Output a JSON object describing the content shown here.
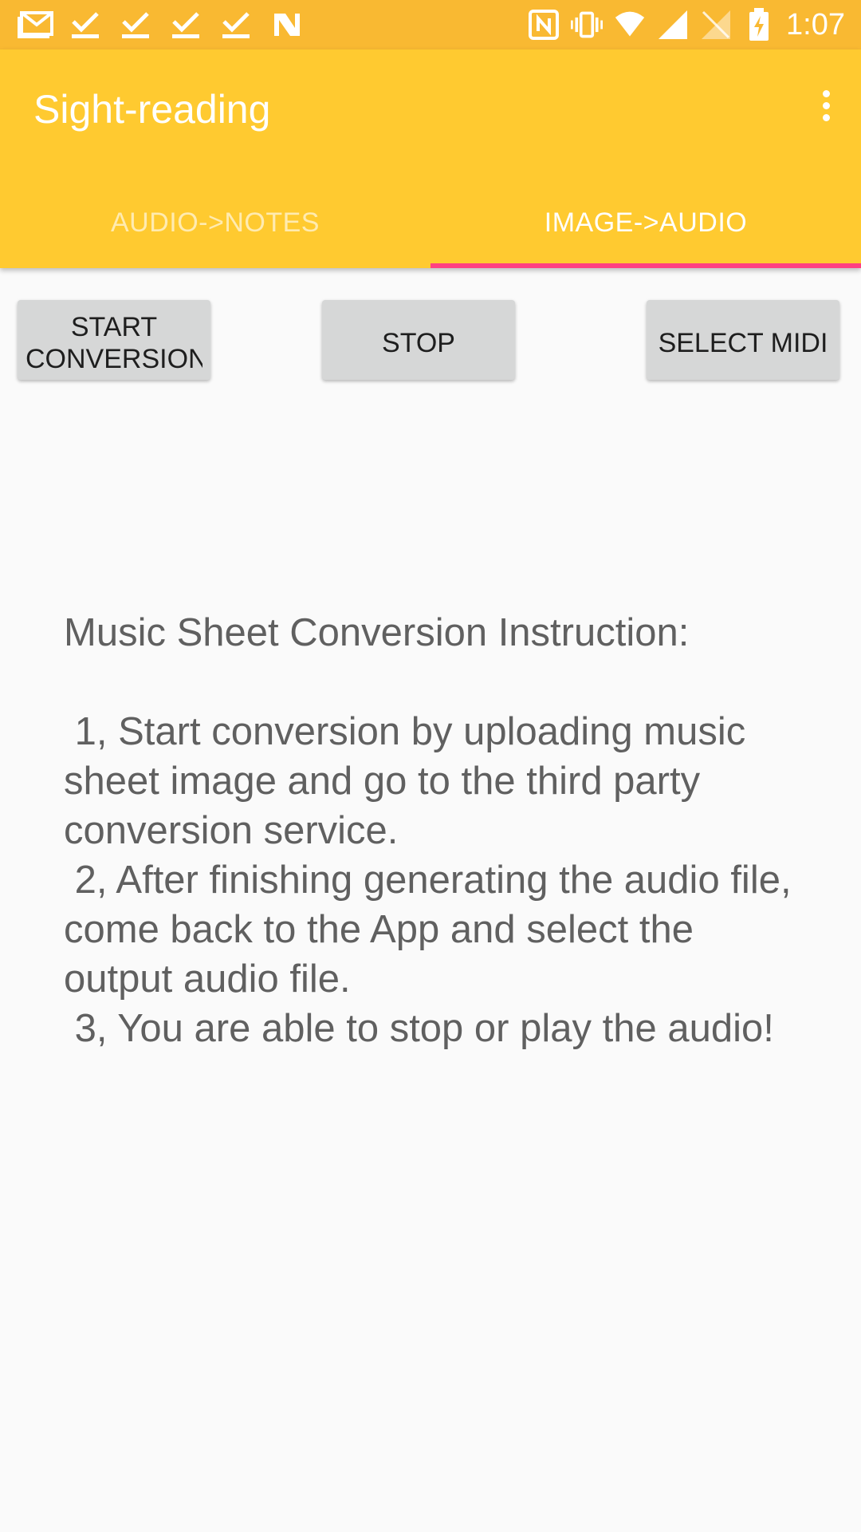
{
  "status_bar": {
    "time": "1:07",
    "left_icons": [
      "gmail-icon",
      "check-icon",
      "check-icon",
      "check-icon",
      "check-icon",
      "n-icon"
    ],
    "right_icons": [
      "nfc-icon",
      "vibrate-icon",
      "wifi-icon",
      "signal-icon",
      "no-signal-icon",
      "battery-charging-icon"
    ]
  },
  "app_bar": {
    "title": "Sight-reading",
    "menu_icon": "more-vert-icon"
  },
  "tabs": [
    {
      "label": "AUDIO->NOTES",
      "selected": false
    },
    {
      "label": "IMAGE->AUDIO",
      "selected": true
    }
  ],
  "buttons": {
    "start": "START CONVERSION",
    "stop": "STOP",
    "select_midi": "SELECT MIDI"
  },
  "instructions": "Music Sheet Conversion Instruction:\n\n 1, Start conversion by uploading music sheet image and go to the third party conversion service.\n 2, After finishing generating the audio file, come back to the App and select the output audio file.\n 3, You are able to stop or play the audio!",
  "colors": {
    "status_bar": "#f9b932",
    "app_bar": "#ffca30",
    "tab_indicator": "#ff4081",
    "background": "#fafafa",
    "button": "#d6d7d7"
  }
}
